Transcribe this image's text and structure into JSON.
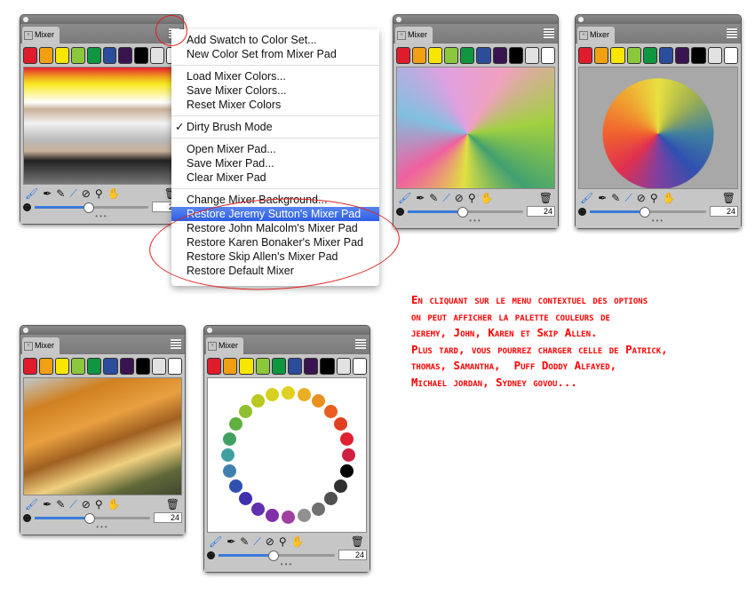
{
  "panel": {
    "tab_label": "Mixer",
    "size_value": "24",
    "dots": "•••"
  },
  "swatch_colors": [
    "#e01c2c",
    "#f0a012",
    "#f8e600",
    "#8cc83c",
    "#109640",
    "#2c4c9c",
    "#3a1450",
    "#000000",
    "#e2e2e2",
    "#ffffff"
  ],
  "tool_icons": [
    "mixer-brush-icon",
    "apply-color-icon",
    "blend-brush-icon",
    "sample-color-icon",
    "sample-multiple-colors-icon",
    "zoom-icon",
    "pan-hand-icon",
    "trash-icon"
  ],
  "menu": {
    "groups": [
      [
        "Add Swatch to Color Set...",
        "New Color Set from Mixer Pad"
      ],
      [
        "Load Mixer Colors...",
        "Save Mixer Colors...",
        "Reset Mixer Colors"
      ],
      [
        "Dirty Brush Mode"
      ],
      [
        "Open Mixer Pad...",
        "Save Mixer Pad...",
        "Clear Mixer Pad"
      ],
      [
        "Change Mixer Background...",
        "Restore Jeremy Sutton's Mixer Pad",
        "Restore John Malcolm's Mixer Pad",
        "Restore Karen Bonaker's Mixer Pad",
        "Restore Skip Allen's Mixer Pad",
        "Restore Default Mixer"
      ]
    ],
    "checked": "Dirty Brush Mode",
    "highlighted": "Restore Jeremy Sutton's Mixer Pad",
    "check_mark": "✓"
  },
  "annotation": {
    "lines": [
      "En cliquant sur le menu contextuel des options",
      "on peut afficher la palette couleurs de",
      "jeremy, John, Karen et Skip Allen.",
      "Plus tard, vous pourrez charger celle de Patrick,",
      "thomas, Samantha,  Puff Doddy Alfayed,",
      "Michael jordan, Sydney govou..."
    ],
    "color": "#ff0000"
  }
}
